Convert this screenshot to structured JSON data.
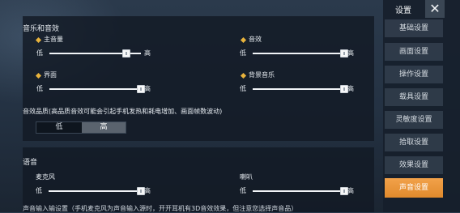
{
  "audio": {
    "section_title": "音乐和音效",
    "controls": {
      "master": {
        "label": "主音量",
        "low": "低",
        "high": "高",
        "value": 0.84
      },
      "sfx": {
        "label": "音效",
        "low": "低",
        "high": "高",
        "value": 1.0
      },
      "ui": {
        "label": "界面",
        "low": "低",
        "high": "高",
        "value": 1.0
      },
      "bgm": {
        "label": "背景音乐",
        "low": "低",
        "high": "高",
        "value": 1.0
      }
    },
    "quality": {
      "label": "音效品质(高品质音效可能会引起手机发热和耗电增加、画面帧数波动)",
      "options": [
        "低",
        "高"
      ],
      "selected": "高"
    }
  },
  "voice": {
    "section_title": "语音",
    "controls": {
      "mic": {
        "label": "麦克风",
        "low": "低",
        "high": "高",
        "value": 1.0
      },
      "speaker": {
        "label": "喇叭",
        "low": "低",
        "high": "高",
        "value": 1.0
      }
    },
    "footer_text": "声音输入输设置（手机麦克风为声音输入源时，开开耳机有3D音效效果，但注意您选择声音品）"
  },
  "sidebar": {
    "title": "设置",
    "close_glyph": "✕",
    "items": [
      "基础设置",
      "画面设置",
      "操作设置",
      "载具设置",
      "灵敏度设置",
      "拾取设置",
      "效果设置",
      "声音设置"
    ],
    "active": "声音设置"
  },
  "colors": {
    "accent": "#e8b33c",
    "active_tab": "#f2a24a"
  }
}
